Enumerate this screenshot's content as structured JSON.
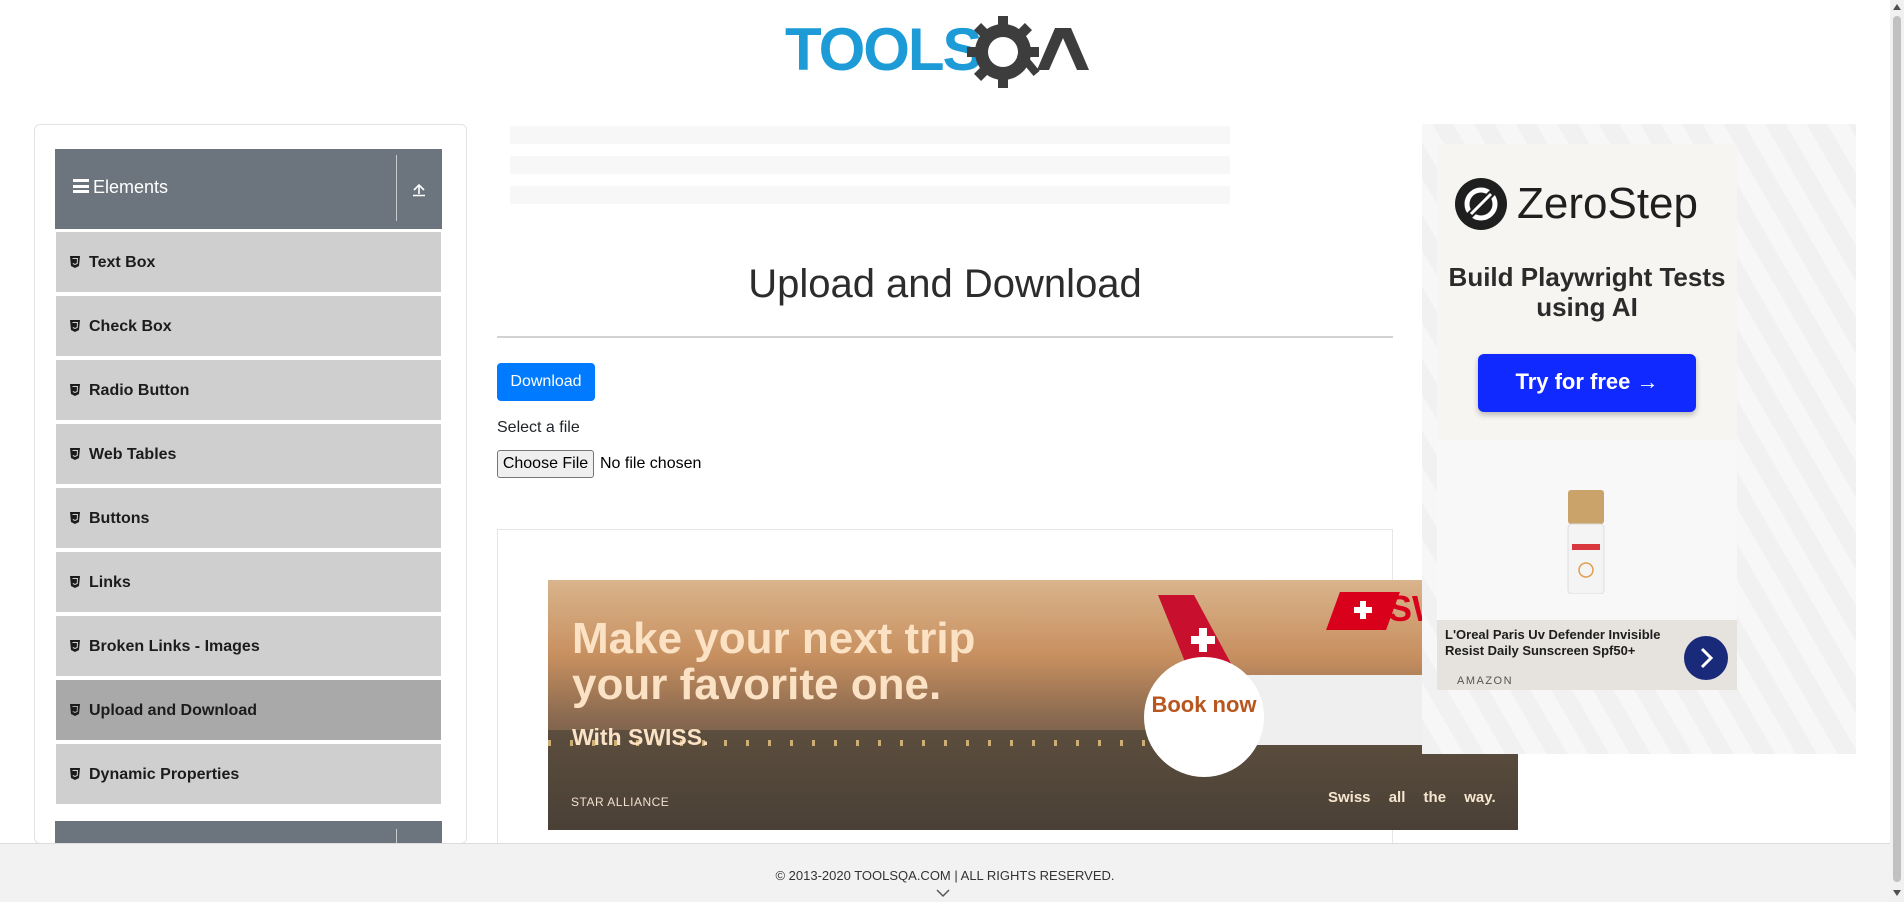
{
  "header": {
    "logo_text": "TOOLSQA"
  },
  "sidebar": {
    "group_title": "Elements",
    "items": [
      {
        "label": "Text Box"
      },
      {
        "label": "Check Box"
      },
      {
        "label": "Radio Button"
      },
      {
        "label": "Web Tables"
      },
      {
        "label": "Buttons"
      },
      {
        "label": "Links"
      },
      {
        "label": "Broken Links - Images"
      },
      {
        "label": "Upload and Download",
        "active": true
      },
      {
        "label": "Dynamic Properties"
      }
    ]
  },
  "main": {
    "title": "Upload and Download",
    "download_button": "Download",
    "select_label": "Select a file",
    "file_input": {
      "button": "Choose File",
      "status": "No file chosen"
    }
  },
  "swiss_ad": {
    "headline": "Make your next trip your favorite one.",
    "subline": "With SWISS.",
    "brand": "SWISS",
    "cta": "Book now",
    "alliance": "STAR ALLIANCE",
    "tagline": "Swiss all the way."
  },
  "right_ad": {
    "brand": "ZeroStep",
    "tagline": "Build Playwright Tests using AI",
    "cta": "Try for free →",
    "product_title": "L'Oreal Paris Uv Defender Invisible Resist Daily Sunscreen Spf50+",
    "product_store": "AMAZON"
  },
  "footer": {
    "copyright": "© 2013-2020 TOOLSQA.COM | ALL RIGHTS RESERVED."
  },
  "colors": {
    "primary": "#007bff",
    "group_header": "#6c757d",
    "menu_item": "#cfcfcf",
    "menu_active": "#a9a9a9",
    "logo_blue": "#1d9bd6"
  }
}
